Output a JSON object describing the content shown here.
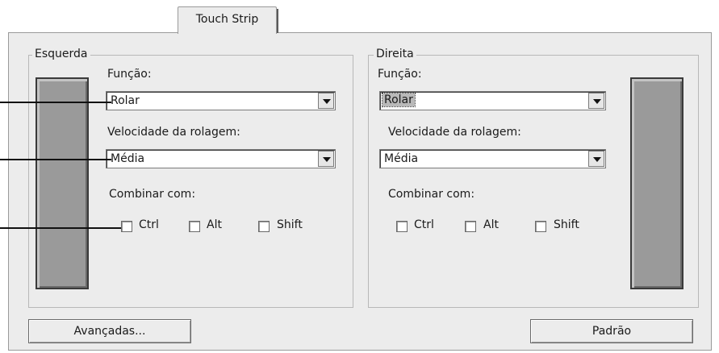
{
  "tab": {
    "label": "Touch Strip"
  },
  "left": {
    "legend": "Esquerda",
    "function_label": "Função:",
    "function_value": "Rolar",
    "speed_label": "Velocidade da rolagem:",
    "speed_value": "Média",
    "combine_label": "Combinar com:",
    "checkboxes": [
      {
        "label": "Ctrl",
        "checked": false
      },
      {
        "label": "Alt",
        "checked": false
      },
      {
        "label": "Shift",
        "checked": false
      }
    ]
  },
  "right": {
    "legend": "Direita",
    "function_label": "Função:",
    "function_value": "Rolar",
    "speed_label": "Velocidade da rolagem:",
    "speed_value": "Média",
    "combine_label": "Combinar com:",
    "checkboxes": [
      {
        "label": "Ctrl",
        "checked": false
      },
      {
        "label": "Alt",
        "checked": false
      },
      {
        "label": "Shift",
        "checked": false
      }
    ]
  },
  "buttons": {
    "advanced": "Avançadas...",
    "default": "Padrão"
  },
  "colors": {
    "panel_bg": "#ececec",
    "strip_fill": "#9a9a9a",
    "callout_line": "#111111"
  }
}
